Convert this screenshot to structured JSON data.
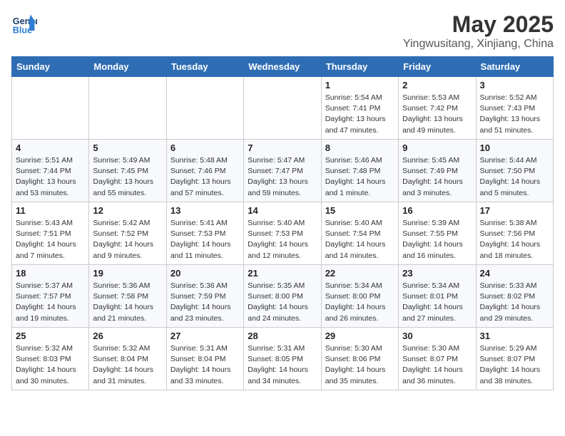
{
  "header": {
    "logo_line1": "General",
    "logo_line2": "Blue",
    "month": "May 2025",
    "location": "Yingwusitang, Xinjiang, China"
  },
  "weekdays": [
    "Sunday",
    "Monday",
    "Tuesday",
    "Wednesday",
    "Thursday",
    "Friday",
    "Saturday"
  ],
  "weeks": [
    [
      {
        "day": "",
        "info": ""
      },
      {
        "day": "",
        "info": ""
      },
      {
        "day": "",
        "info": ""
      },
      {
        "day": "",
        "info": ""
      },
      {
        "day": "1",
        "info": "Sunrise: 5:54 AM\nSunset: 7:41 PM\nDaylight: 13 hours\nand 47 minutes."
      },
      {
        "day": "2",
        "info": "Sunrise: 5:53 AM\nSunset: 7:42 PM\nDaylight: 13 hours\nand 49 minutes."
      },
      {
        "day": "3",
        "info": "Sunrise: 5:52 AM\nSunset: 7:43 PM\nDaylight: 13 hours\nand 51 minutes."
      }
    ],
    [
      {
        "day": "4",
        "info": "Sunrise: 5:51 AM\nSunset: 7:44 PM\nDaylight: 13 hours\nand 53 minutes."
      },
      {
        "day": "5",
        "info": "Sunrise: 5:49 AM\nSunset: 7:45 PM\nDaylight: 13 hours\nand 55 minutes."
      },
      {
        "day": "6",
        "info": "Sunrise: 5:48 AM\nSunset: 7:46 PM\nDaylight: 13 hours\nand 57 minutes."
      },
      {
        "day": "7",
        "info": "Sunrise: 5:47 AM\nSunset: 7:47 PM\nDaylight: 13 hours\nand 59 minutes."
      },
      {
        "day": "8",
        "info": "Sunrise: 5:46 AM\nSunset: 7:48 PM\nDaylight: 14 hours\nand 1 minute."
      },
      {
        "day": "9",
        "info": "Sunrise: 5:45 AM\nSunset: 7:49 PM\nDaylight: 14 hours\nand 3 minutes."
      },
      {
        "day": "10",
        "info": "Sunrise: 5:44 AM\nSunset: 7:50 PM\nDaylight: 14 hours\nand 5 minutes."
      }
    ],
    [
      {
        "day": "11",
        "info": "Sunrise: 5:43 AM\nSunset: 7:51 PM\nDaylight: 14 hours\nand 7 minutes."
      },
      {
        "day": "12",
        "info": "Sunrise: 5:42 AM\nSunset: 7:52 PM\nDaylight: 14 hours\nand 9 minutes."
      },
      {
        "day": "13",
        "info": "Sunrise: 5:41 AM\nSunset: 7:53 PM\nDaylight: 14 hours\nand 11 minutes."
      },
      {
        "day": "14",
        "info": "Sunrise: 5:40 AM\nSunset: 7:53 PM\nDaylight: 14 hours\nand 12 minutes."
      },
      {
        "day": "15",
        "info": "Sunrise: 5:40 AM\nSunset: 7:54 PM\nDaylight: 14 hours\nand 14 minutes."
      },
      {
        "day": "16",
        "info": "Sunrise: 5:39 AM\nSunset: 7:55 PM\nDaylight: 14 hours\nand 16 minutes."
      },
      {
        "day": "17",
        "info": "Sunrise: 5:38 AM\nSunset: 7:56 PM\nDaylight: 14 hours\nand 18 minutes."
      }
    ],
    [
      {
        "day": "18",
        "info": "Sunrise: 5:37 AM\nSunset: 7:57 PM\nDaylight: 14 hours\nand 19 minutes."
      },
      {
        "day": "19",
        "info": "Sunrise: 5:36 AM\nSunset: 7:58 PM\nDaylight: 14 hours\nand 21 minutes."
      },
      {
        "day": "20",
        "info": "Sunrise: 5:36 AM\nSunset: 7:59 PM\nDaylight: 14 hours\nand 23 minutes."
      },
      {
        "day": "21",
        "info": "Sunrise: 5:35 AM\nSunset: 8:00 PM\nDaylight: 14 hours\nand 24 minutes."
      },
      {
        "day": "22",
        "info": "Sunrise: 5:34 AM\nSunset: 8:00 PM\nDaylight: 14 hours\nand 26 minutes."
      },
      {
        "day": "23",
        "info": "Sunrise: 5:34 AM\nSunset: 8:01 PM\nDaylight: 14 hours\nand 27 minutes."
      },
      {
        "day": "24",
        "info": "Sunrise: 5:33 AM\nSunset: 8:02 PM\nDaylight: 14 hours\nand 29 minutes."
      }
    ],
    [
      {
        "day": "25",
        "info": "Sunrise: 5:32 AM\nSunset: 8:03 PM\nDaylight: 14 hours\nand 30 minutes."
      },
      {
        "day": "26",
        "info": "Sunrise: 5:32 AM\nSunset: 8:04 PM\nDaylight: 14 hours\nand 31 minutes."
      },
      {
        "day": "27",
        "info": "Sunrise: 5:31 AM\nSunset: 8:04 PM\nDaylight: 14 hours\nand 33 minutes."
      },
      {
        "day": "28",
        "info": "Sunrise: 5:31 AM\nSunset: 8:05 PM\nDaylight: 14 hours\nand 34 minutes."
      },
      {
        "day": "29",
        "info": "Sunrise: 5:30 AM\nSunset: 8:06 PM\nDaylight: 14 hours\nand 35 minutes."
      },
      {
        "day": "30",
        "info": "Sunrise: 5:30 AM\nSunset: 8:07 PM\nDaylight: 14 hours\nand 36 minutes."
      },
      {
        "day": "31",
        "info": "Sunrise: 5:29 AM\nSunset: 8:07 PM\nDaylight: 14 hours\nand 38 minutes."
      }
    ]
  ]
}
